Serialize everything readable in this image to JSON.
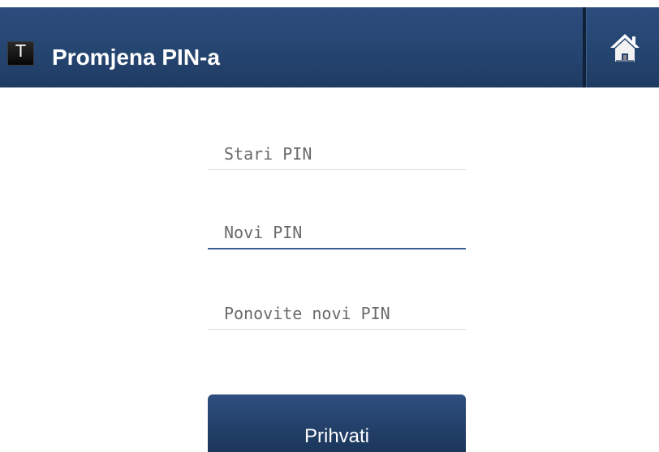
{
  "header": {
    "logo_letter": "T",
    "title": "Promjena PIN-a",
    "home_icon": "home-icon"
  },
  "form": {
    "old_pin": {
      "value": "",
      "placeholder": "Stari PIN"
    },
    "new_pin": {
      "value": "",
      "placeholder": "Novi PIN",
      "focused": true
    },
    "repeat_pin": {
      "value": "",
      "placeholder": "Ponovite novi PIN"
    },
    "accept_label": "Prihvati"
  },
  "colors": {
    "header_bg": "#254571",
    "button_bg": "#223f68",
    "focus_underline": "#3c5f93"
  }
}
